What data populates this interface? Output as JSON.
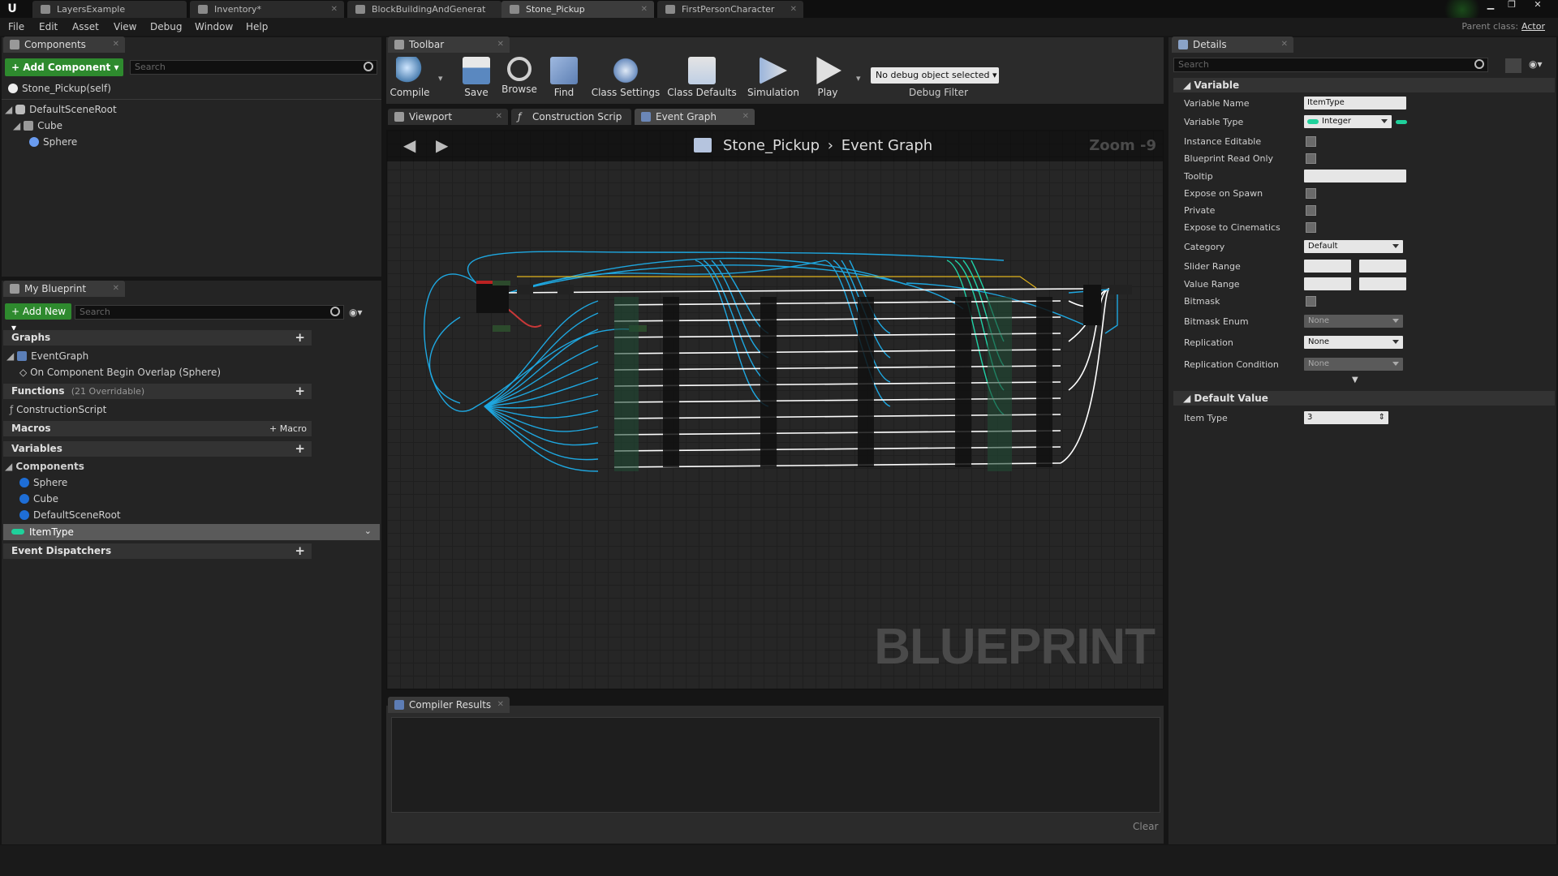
{
  "tabs": [
    {
      "label": "LayersExample"
    },
    {
      "label": "Inventory*"
    },
    {
      "label": "BlockBuildingAndGenerat"
    },
    {
      "label": "Stone_Pickup"
    },
    {
      "label": "FirstPersonCharacter"
    }
  ],
  "parent_class_label": "Parent class:",
  "parent_class_value": "Actor",
  "menu": [
    "File",
    "Edit",
    "Asset",
    "View",
    "Debug",
    "Window",
    "Help"
  ],
  "components_panel": {
    "title": "Components",
    "add_button": "Add Component",
    "search_placeholder": "Search",
    "self_item": "Stone_Pickup(self)",
    "tree": [
      "DefaultSceneRoot",
      "Cube",
      "Sphere"
    ]
  },
  "my_blueprint": {
    "title": "My Blueprint",
    "add_button": "Add New",
    "search_placeholder": "Search",
    "graphs_label": "Graphs",
    "event_graph": "EventGraph",
    "overlap_event": "On Component Begin Overlap (Sphere)",
    "functions_label": "Functions",
    "functions_count": "(21 Overridable)",
    "construction_script": "ConstructionScript",
    "macros_label": "Macros",
    "macro_button": "Macro",
    "variables_label": "Variables",
    "components_label": "Components",
    "var_components": [
      "Sphere",
      "Cube",
      "DefaultSceneRoot"
    ],
    "selected_var": "ItemType",
    "event_dispatchers": "Event Dispatchers"
  },
  "toolbar": {
    "title": "Toolbar",
    "compile": "Compile",
    "save": "Save",
    "browse": "Browse",
    "find": "Find",
    "class_settings": "Class Settings",
    "class_defaults": "Class Defaults",
    "simulation": "Simulation",
    "play": "Play",
    "debug_object": "No debug object selected",
    "debug_filter": "Debug Filter"
  },
  "editor_tabs": [
    "Viewport",
    "Construction Scrip",
    "Event Graph"
  ],
  "graph": {
    "breadcrumb_root": "Stone_Pickup",
    "breadcrumb_leaf": "Event Graph",
    "zoom": "Zoom -9",
    "watermark": "BLUEPRINT"
  },
  "compiler": {
    "title": "Compiler Results",
    "clear": "Clear"
  },
  "details": {
    "title": "Details",
    "search_placeholder": "Search",
    "variable_section": "Variable",
    "rows": {
      "variable_name": "Variable Name",
      "variable_type": "Variable Type",
      "instance_editable": "Instance Editable",
      "blueprint_read_only": "Blueprint Read Only",
      "tooltip": "Tooltip",
      "expose_on_spawn": "Expose on Spawn",
      "private": "Private",
      "expose_to_cinematics": "Expose to Cinematics",
      "category": "Category",
      "slider_range": "Slider Range",
      "value_range": "Value Range",
      "bitmask": "Bitmask",
      "bitmask_enum": "Bitmask Enum",
      "replication": "Replication",
      "replication_condition": "Replication Condition"
    },
    "values": {
      "variable_name": "ItemType",
      "variable_type": "Integer",
      "category": "Default",
      "bitmask_enum": "None",
      "replication": "None",
      "replication_condition": "None"
    },
    "default_section": "Default Value",
    "item_type_label": "Item Type",
    "item_type_value": "3"
  },
  "colors": {
    "accent_green": "#2e8a2e",
    "integer_pin": "#1fd19b",
    "wire_blue": "#1ea7e0",
    "wire_teal": "#1fd1a5"
  }
}
